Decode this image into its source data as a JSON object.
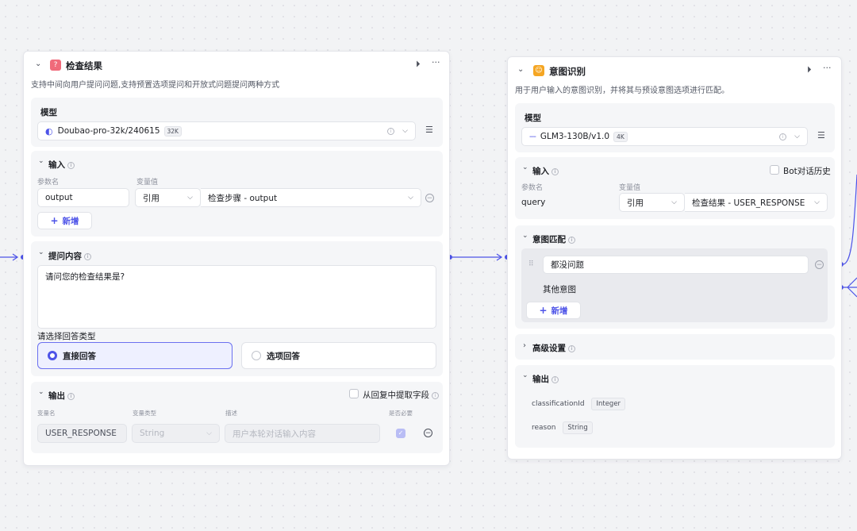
{
  "node1": {
    "title": "检查结果",
    "description": "支持中间向用户提问问题,支持预置选项提问和开放式问题提问两种方式",
    "model": {
      "title": "模型",
      "value": "Doubao-pro-32k/240615",
      "badge": "32K"
    },
    "input": {
      "title": "输入",
      "param_label": "参数名",
      "value_label": "变量值",
      "param": "output",
      "ref_type": "引用",
      "ref_value": "检查步骤 - output",
      "add_label": "新增"
    },
    "question": {
      "title": "提问内容",
      "text": "请问您的检查结果是?",
      "answer_type_label": "请选择回答类型",
      "option_direct": "直接回答",
      "option_choice": "选项回答"
    },
    "output": {
      "title": "输出",
      "extract_label": "从回复中提取字段",
      "col_name": "变量名",
      "col_type": "变量类型",
      "col_desc": "描述",
      "col_required": "是否必要",
      "var_name": "USER_RESPONSE",
      "var_type": "String",
      "var_desc_placeholder": "用户本轮对话输入内容"
    }
  },
  "node2": {
    "title": "意图识别",
    "description": "用于用户输入的意图识别，并将其与预设意图选项进行匹配。",
    "model": {
      "title": "模型",
      "value": "GLM3-130B/v1.0",
      "badge": "4K"
    },
    "input": {
      "title": "输入",
      "history_label": "Bot对话历史",
      "param_label": "参数名",
      "value_label": "变量值",
      "param": "query",
      "ref_type": "引用",
      "ref_value": "检查结果 - USER_RESPONSE"
    },
    "intent": {
      "title": "意图匹配",
      "item1": "都没问题",
      "other": "其他意图",
      "add_label": "新增"
    },
    "advanced": {
      "title": "高级设置"
    },
    "output": {
      "title": "输出",
      "rows": [
        {
          "name": "classificationId",
          "type": "Integer"
        },
        {
          "name": "reason",
          "type": "String"
        }
      ]
    }
  },
  "colors": {
    "accent": "#4d53e8",
    "node1_icon": "#f06a7a",
    "node2_icon": "#f5a623"
  }
}
